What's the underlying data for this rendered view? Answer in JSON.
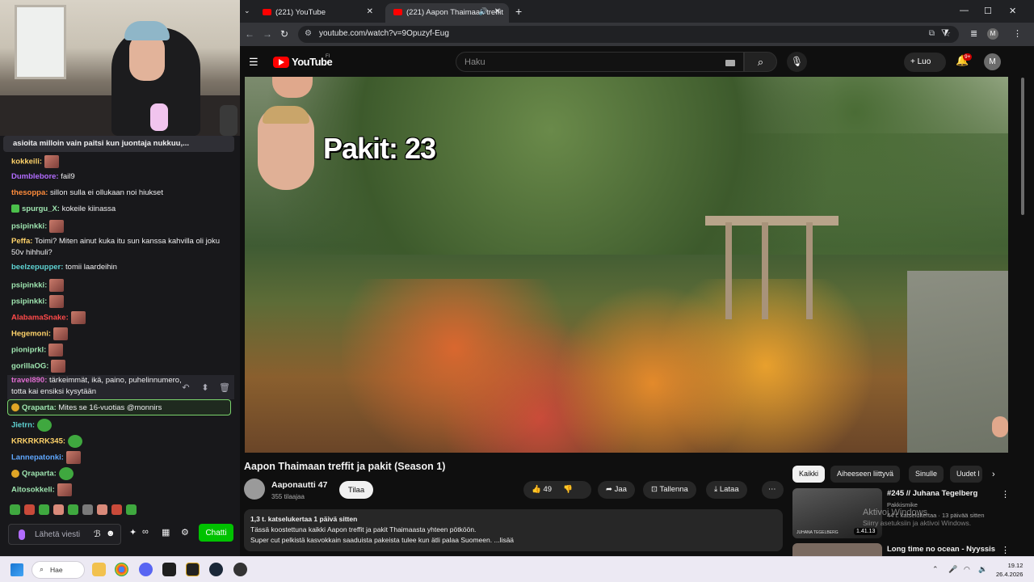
{
  "chat": {
    "pinned": "asioita milloin vain paitsi kun juontaja nukkuu,...",
    "messages": [
      {
        "user": "kokkeili:",
        "text": "",
        "color": "#ffd36a"
      },
      {
        "user": "Dumblebore:",
        "text": " fail9",
        "color": "#b26cff"
      },
      {
        "user": "thesoppa:",
        "text": " sillon sulla ei ollukaan noi hiukset",
        "color": "#ff8c3b"
      },
      {
        "user": "spurgu_X:",
        "text": " kokeile kiinassa",
        "color": "#9fe5b0"
      },
      {
        "user": "psipinkki:",
        "text": "",
        "color": "#9fe5b0"
      },
      {
        "user": "Peffa:",
        "text": " Toimi? Miten ainut kuka itu sun kanssa kahvilla oli joku",
        "color": "#ffd36a"
      },
      {
        "user": "",
        "text": "50v hihhuli?",
        "color": "#ffd36a"
      },
      {
        "user": "beelzepupper:",
        "text": " tomii laardeihin",
        "color": "#5fd3d3"
      },
      {
        "user": "psipinkki:",
        "text": "",
        "color": "#9fe5b0"
      },
      {
        "user": "psipinkki:",
        "text": "",
        "color": "#9fe5b0"
      },
      {
        "user": "AlabamaSnake:",
        "text": "",
        "color": "#ff4a4a"
      },
      {
        "user": "Hegemoni:",
        "text": "",
        "color": "#ffd36a"
      },
      {
        "user": "pioniprkl:",
        "text": "",
        "color": "#9fe5b0"
      },
      {
        "user": "gorillaOG:",
        "text": "",
        "color": "#9fe5b0"
      },
      {
        "user": "travel890:",
        "text": " tärkeimmät, ikä, paino, puhelinnumero,",
        "color": "#e06cd0"
      },
      {
        "user": "",
        "text": "totta kai ensiksi kysytään",
        "color": "#e06cd0"
      },
      {
        "user": "Qraparta:",
        "text": " Mites se 16-vuotias @monnirs",
        "color": "#9fe5b0"
      },
      {
        "user": "Jietrn:",
        "text": "",
        "color": "#5fd3d3"
      },
      {
        "user": "KRKRKRK345:",
        "text": "",
        "color": "#ffd36a"
      },
      {
        "user": "Lannepatonki:",
        "text": "",
        "color": "#5fa8ff"
      },
      {
        "user": "Qraparta:",
        "text": "",
        "color": "#9fe5b0"
      },
      {
        "user": "Aitosokkeli:",
        "text": "",
        "color": "#9fe5b0"
      }
    ],
    "input_placeholder": "Lähetä viesti",
    "send_label": "Chatti"
  },
  "browser": {
    "tabs": [
      {
        "label": "(221) YouTube"
      },
      {
        "label": "(221) Aapon Thaimaan treffit"
      }
    ],
    "url": "youtube.com/watch?v=9Opuzyf-Eug",
    "profile_initial": "M"
  },
  "youtube": {
    "logo_text": "YouTube",
    "region": "FI",
    "search_placeholder": "Haku",
    "create_label": "Luo",
    "notif_count": "9+",
    "avatar_initial": "M",
    "overlay_text": "Pakit: 23",
    "video_title": "Aapon Thaimaan treffit ja pakit (Season 1)",
    "channel_name": "Aaponautti 47",
    "subscribers": "355 tilaajaa",
    "subscribe_label": "Tilaa",
    "like_count": "49",
    "share_label": "Jaa",
    "save_label": "Tallenna",
    "download_label": "Lataa",
    "desc_stats": "1,3 t. katselukertaa  1 päivä sitten",
    "desc_line1": "Tässä koostettuna kaikki Aapon treffit ja pakit Thaimaasta yhteen pötköön.",
    "desc_line2": "Super cut pelkistä kasvokkain saaduista pakeista tulee kun ätli palaa Suomeen. ...lisää",
    "chips": [
      "Kaikki",
      "Aiheeseen liittyvä",
      "Sinulle",
      "Uudet l"
    ],
    "rec1": {
      "title": "#245 // Juhana Tegelberg",
      "channel": "Pakkismike",
      "meta": "44 t. katselukertaa · 13 päivää sitten",
      "duration": "1.41.13",
      "thumb_caption": "JUHANA TEGELBERG"
    },
    "rec2": {
      "title": "Long time no ocean - Nyyssis"
    },
    "activate_title": "Aktivoi Windows",
    "activate_sub": "Siirry asetuksiin ja aktivoi Windows."
  },
  "taskbar": {
    "search_label": "Hae",
    "time": "19.12",
    "date": "26.4.2026"
  }
}
